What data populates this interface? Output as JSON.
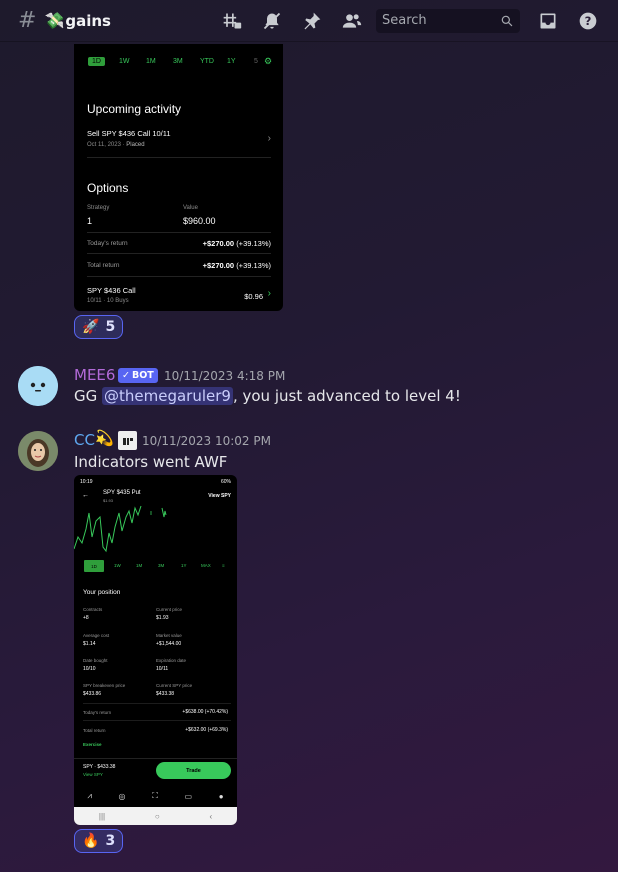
{
  "header": {
    "channel_emoji": "💸",
    "channel_name": "gains",
    "search_placeholder": "Search"
  },
  "screenshot1": {
    "ranges": [
      "1D",
      "1W",
      "1M",
      "3M",
      "YTD",
      "1Y",
      "5"
    ],
    "upcoming_title": "Upcoming activity",
    "upcoming_item": "Sell SPY $436 Call 10/11",
    "upcoming_date": "Oct 11, 2023 · ",
    "upcoming_status": "Placed",
    "options_title": "Options",
    "strategy_label": "Strategy",
    "strategy_value": "1",
    "value_label": "Value",
    "value_value": "$960.00",
    "today_return_label": "Today's return",
    "today_return_value": "+$270.00",
    "today_return_pct": "(+39.13%)",
    "total_return_label": "Total return",
    "total_return_value": "+$270.00",
    "total_return_pct": "(+39.13%)",
    "contract_name": "SPY $436 Call",
    "contract_sub": "10/11 · 10 Buys",
    "contract_price": "$0.96"
  },
  "reaction1": {
    "emoji": "🚀",
    "count": "5"
  },
  "message_mee6": {
    "username": "MEE6",
    "bot_label": "BOT",
    "timestamp": "10/11/2023 4:18 PM",
    "text_prefix": "GG ",
    "mention": "@themegaruler9",
    "text_suffix": ", you just advanced to level 4!",
    "username_color": "#b26ad8"
  },
  "message_cc": {
    "username": "CC",
    "username_emoji": "💫",
    "timestamp": "10/11/2023 10:02 PM",
    "text": "Indicators went AWF",
    "username_color": "#5ea8f0"
  },
  "screenshot2": {
    "status_time": "10:19",
    "status_battery": "60%",
    "title": "SPY $435 Put",
    "subtitle": "$1.93",
    "view_link": "View SPY",
    "ranges": [
      "1D",
      "1W",
      "1M",
      "3M",
      "1Y",
      "MAX"
    ],
    "position_title": "Your position",
    "contracts_label": "Contracts",
    "contracts_value": "+8",
    "current_price_label": "Current price",
    "current_price_value": "$1.93",
    "avg_cost_label": "Average cost",
    "avg_cost_value": "$1.14",
    "market_value_label": "Market value",
    "market_value_value": "+$1,544.00",
    "date_bought_label": "Date bought",
    "date_bought_value": "10/10",
    "expiration_label": "Expiration date",
    "expiration_value": "10/11",
    "breakeven_label": "SPY breakeven price",
    "breakeven_value": "$433.86",
    "current_spy_label": "Current SPY price",
    "current_spy_value": "$433.38",
    "today_return_label": "Today's return",
    "today_return_value": "+$638.00 (+70.42%)",
    "total_return_label": "Total return",
    "total_return_value": "+$632.00 (+69.3%)",
    "exercise_label": "Exercise",
    "footer_spy": "SPY · $433.38",
    "footer_view": "View SPY",
    "trade_button": "Trade"
  },
  "reaction2": {
    "emoji": "🔥",
    "count": "3"
  }
}
